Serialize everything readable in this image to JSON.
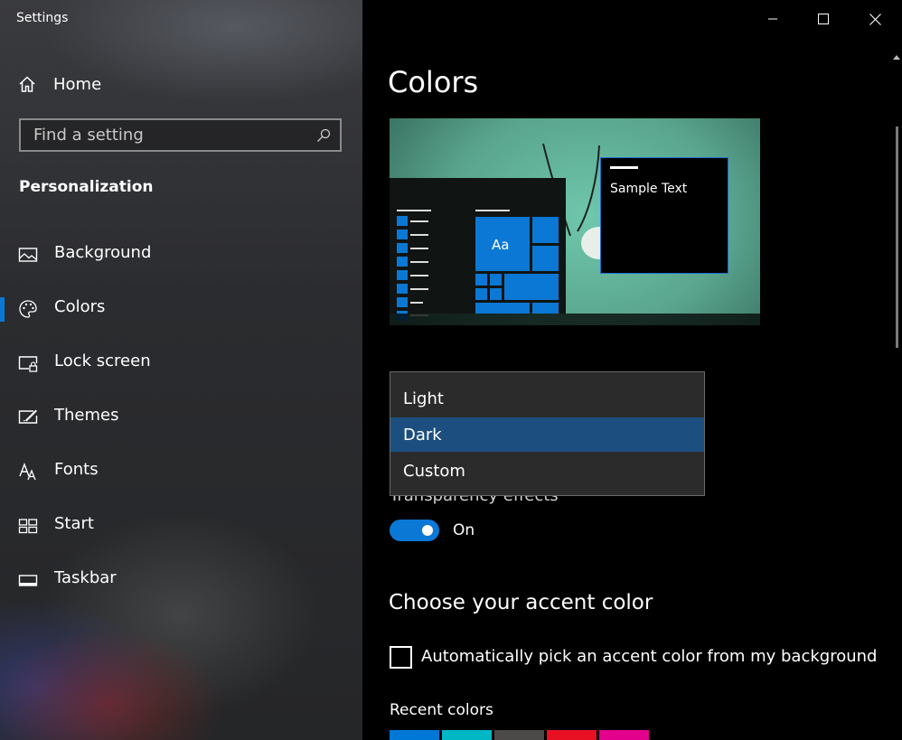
{
  "window": {
    "title": "Settings"
  },
  "sidebar": {
    "home_label": "Home",
    "search_placeholder": "Find a setting",
    "section_title": "Personalization",
    "items": [
      {
        "label": "Background",
        "icon": "picture-icon"
      },
      {
        "label": "Colors",
        "icon": "palette-icon",
        "selected": true
      },
      {
        "label": "Lock screen",
        "icon": "lock-screen-icon"
      },
      {
        "label": "Themes",
        "icon": "themes-icon"
      },
      {
        "label": "Fonts",
        "icon": "fonts-icon"
      },
      {
        "label": "Start",
        "icon": "start-icon"
      },
      {
        "label": "Taskbar",
        "icon": "taskbar-icon"
      }
    ]
  },
  "main": {
    "title": "Colors",
    "preview": {
      "sample_text": "Sample Text",
      "tile_text": "Aa"
    },
    "mode_dropdown": {
      "options": [
        "Light",
        "Dark",
        "Custom"
      ],
      "selected": "Dark"
    },
    "transparency": {
      "label": "Transparency effects",
      "state_label": "On",
      "on": true
    },
    "accent": {
      "title": "Choose your accent color",
      "auto_pick_label": "Automatically pick an accent color from my background",
      "auto_pick_checked": false,
      "recent_title": "Recent colors",
      "recent_colors": [
        "#0078d7",
        "#00b7c3",
        "#4c4a48",
        "#e81123",
        "#e3008c"
      ]
    }
  },
  "colors": {
    "accent": "#0a78d4",
    "dropdown_selected": "#1c4f80"
  }
}
